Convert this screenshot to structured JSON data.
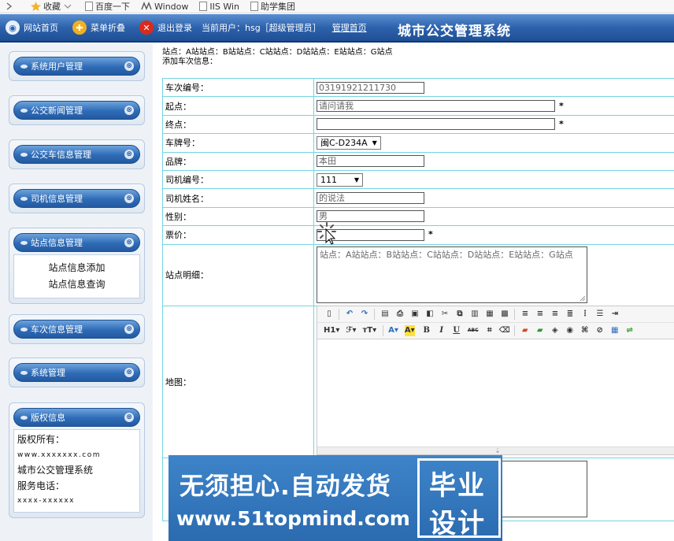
{
  "favorites": [
    "收藏",
    "百度一下",
    "Window",
    "IIS Win",
    "助学集团"
  ],
  "topbar": {
    "site_home": "网站首页",
    "menu_fold": "菜单折叠",
    "logout": "退出登录",
    "current_user": "当前用户：hsg［超级管理员］",
    "admin_home": "管理首页",
    "title": "城市公交管理系统"
  },
  "sidebar": {
    "menus": [
      "系统用户管理",
      "公交新闻管理",
      "公交车信息管理",
      "司机信息管理",
      "站点信息管理",
      "车次信息管理",
      "系统管理",
      "版权信息"
    ],
    "station_sub": [
      "站点信息添加",
      "站点信息查询"
    ],
    "copyright_lines": [
      "版权所有：",
      "www.xxxxxxx.com",
      "城市公交管理系统",
      "服务电话：",
      "xxxx-xxxxxx"
    ]
  },
  "main": {
    "summary_line1": "站点：A站站点：B站站点：C站站点：D站站点：E站站点：G站点",
    "summary_line2": "添加车次信息：",
    "fields": {
      "trip_no_label": "车次编号：",
      "trip_no_value": "03191921211730",
      "start_label": "起点：",
      "start_value": "请问请我",
      "end_label": "终点：",
      "end_value": "",
      "plate_label": "车牌号：",
      "plate_value": "闽C-D234A",
      "brand_label": "品牌：",
      "brand_value": "本田",
      "driver_no_label": "司机编号：",
      "driver_no_value": "111",
      "driver_name_label": "司机姓名：",
      "driver_name_value": "的说法",
      "gender_label": "性别：",
      "gender_value": "男",
      "fare_label": "票价：",
      "fare_value": "",
      "stations_label": "站点明细：",
      "stations_value": "站点：A站站点：B站站点：C站站点：D站站点：E站站点：G站点",
      "map_label": "地图：",
      "required_mark": "*"
    },
    "editor_row2": [
      "H1",
      "ℱ",
      "тT",
      "A",
      "A",
      "B",
      "I",
      "U",
      "ABC"
    ]
  },
  "watermark": {
    "line1": "无须担心.自动发货",
    "line2": "www.51topmind.com",
    "badge1": "毕业",
    "badge2": "设计"
  }
}
